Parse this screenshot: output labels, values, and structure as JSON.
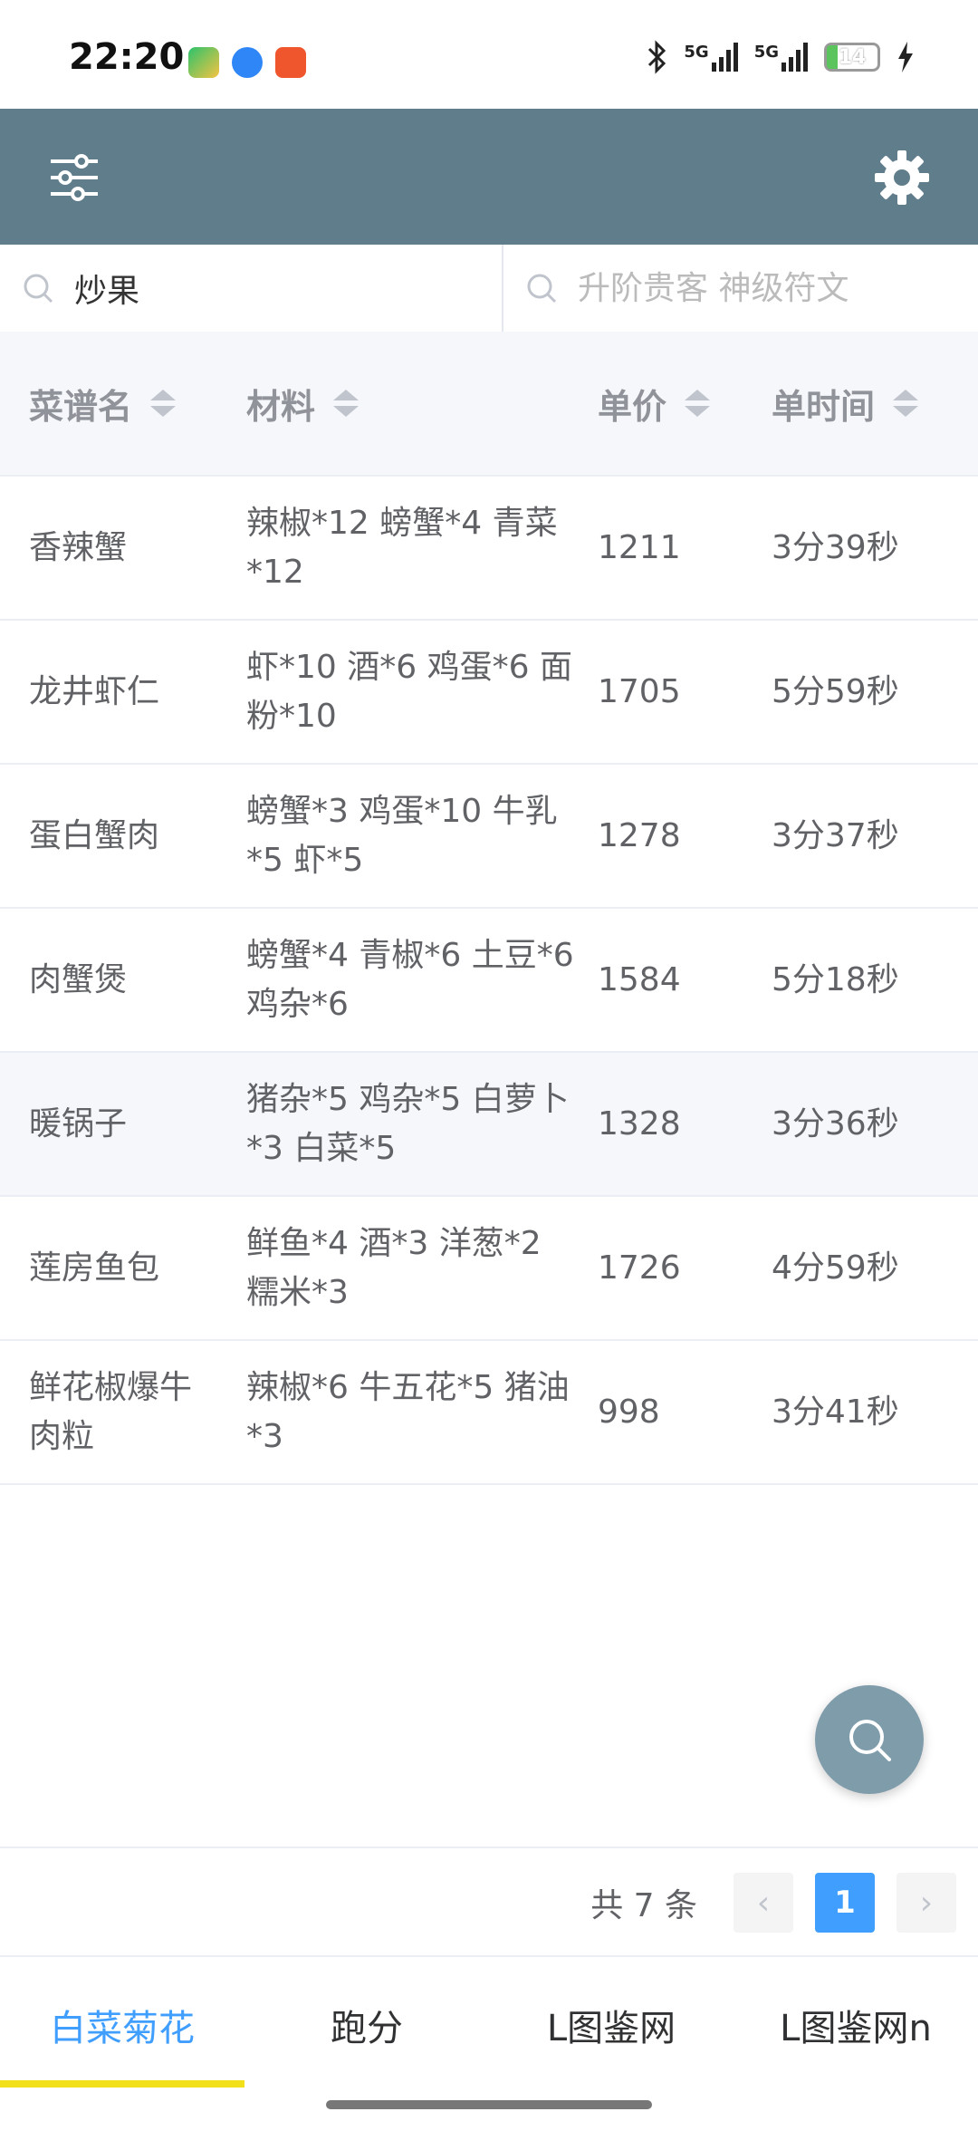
{
  "status_bar": {
    "time": "22:20",
    "network_1": "5G",
    "network_2": "5G",
    "battery": "14"
  },
  "search": {
    "left_value": "炒果",
    "right_placeholder": "升阶贵客 神级符文"
  },
  "table": {
    "headers": [
      "菜谱名",
      "材料",
      "单价",
      "单时间"
    ],
    "rows": [
      {
        "name": "香辣蟹",
        "materials": "辣椒*12 螃蟹*4 青菜*12",
        "price": "1211",
        "time": "3分39秒"
      },
      {
        "name": "龙井虾仁",
        "materials": "虾*10 酒*6 鸡蛋*6 面粉*10",
        "price": "1705",
        "time": "5分59秒"
      },
      {
        "name": "蛋白蟹肉",
        "materials": "螃蟹*3 鸡蛋*10 牛乳*5 虾*5",
        "price": "1278",
        "time": "3分37秒"
      },
      {
        "name": "肉蟹煲",
        "materials": "螃蟹*4 青椒*6 土豆*6 鸡杂*6",
        "price": "1584",
        "time": "5分18秒"
      },
      {
        "name": "暖锅子",
        "materials": "猪杂*5 鸡杂*5 白萝卜*3 白菜*5",
        "price": "1328",
        "time": "3分36秒"
      },
      {
        "name": "莲房鱼包",
        "materials": "鲜鱼*4 酒*3 洋葱*2 糯米*3",
        "price": "1726",
        "time": "4分59秒"
      },
      {
        "name": "鲜花椒爆牛肉粒",
        "materials": "辣椒*6 牛五花*5 猪油*3",
        "price": "998",
        "time": "3分41秒"
      }
    ]
  },
  "pagination": {
    "total": "共 7 条",
    "current_page": "1",
    "prev": "‹",
    "next": "›"
  },
  "tabs": [
    "白菜菊花",
    "跑分",
    "L图鉴网",
    "L图鉴网n"
  ],
  "colors": {
    "appbar": "#607d8b",
    "accent": "#409eff",
    "tab_indicator": "#f2e01a",
    "fab": "#7f9cab"
  }
}
